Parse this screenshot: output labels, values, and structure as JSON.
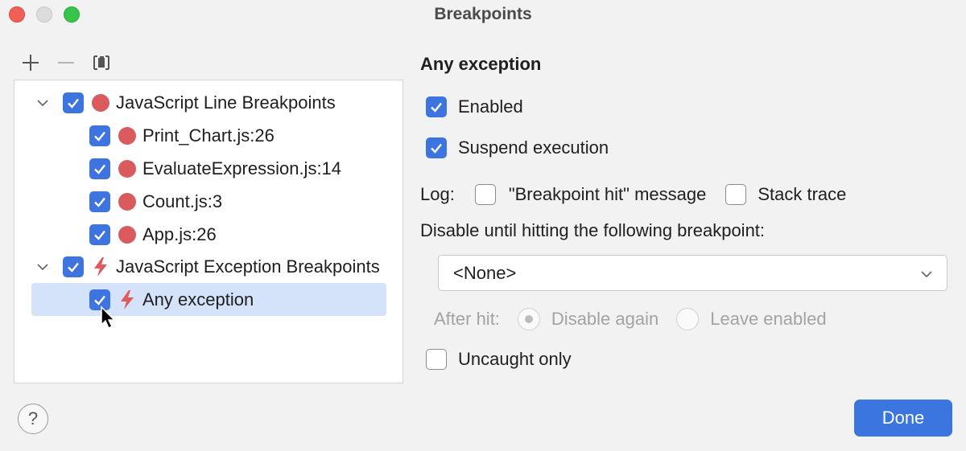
{
  "window": {
    "title": "Breakpoints"
  },
  "toolbar": {
    "add_icon": "plus-icon",
    "remove_icon": "minus-icon",
    "group_icon": "group-by-file-icon"
  },
  "tree": {
    "groups": [
      {
        "label": "JavaScript Line Breakpoints",
        "checked": true,
        "icon": "breakpoint-dot-icon",
        "items": [
          {
            "label": "Print_Chart.js:26",
            "checked": true
          },
          {
            "label": "EvaluateExpression.js:14",
            "checked": true
          },
          {
            "label": "Count.js:3",
            "checked": true
          },
          {
            "label": "App.js:26",
            "checked": true
          }
        ]
      },
      {
        "label": "JavaScript Exception Breakpoints",
        "checked": true,
        "icon": "lightning-icon",
        "items": [
          {
            "label": "Any exception",
            "checked": true,
            "selected": true
          }
        ]
      }
    ]
  },
  "details": {
    "title": "Any exception",
    "enabled": {
      "label": "Enabled",
      "checked": true
    },
    "suspend": {
      "label": "Suspend execution",
      "checked": true
    },
    "log": {
      "label": "Log:",
      "message": {
        "label": "\"Breakpoint hit\" message",
        "checked": false
      },
      "stack": {
        "label": "Stack trace",
        "checked": false
      }
    },
    "disable_until": {
      "label": "Disable until hitting the following breakpoint:",
      "selected": "<None>"
    },
    "after_hit": {
      "label": "After hit:",
      "disable_again": "Disable again",
      "leave_enabled": "Leave enabled",
      "selected": "Disable again"
    },
    "uncaught": {
      "label": "Uncaught only",
      "checked": false
    }
  },
  "footer": {
    "help": "?",
    "done": "Done"
  },
  "colors": {
    "accent": "#3d74e0",
    "breakpoint": "#d95b5e",
    "selection": "#d4e2fa"
  }
}
